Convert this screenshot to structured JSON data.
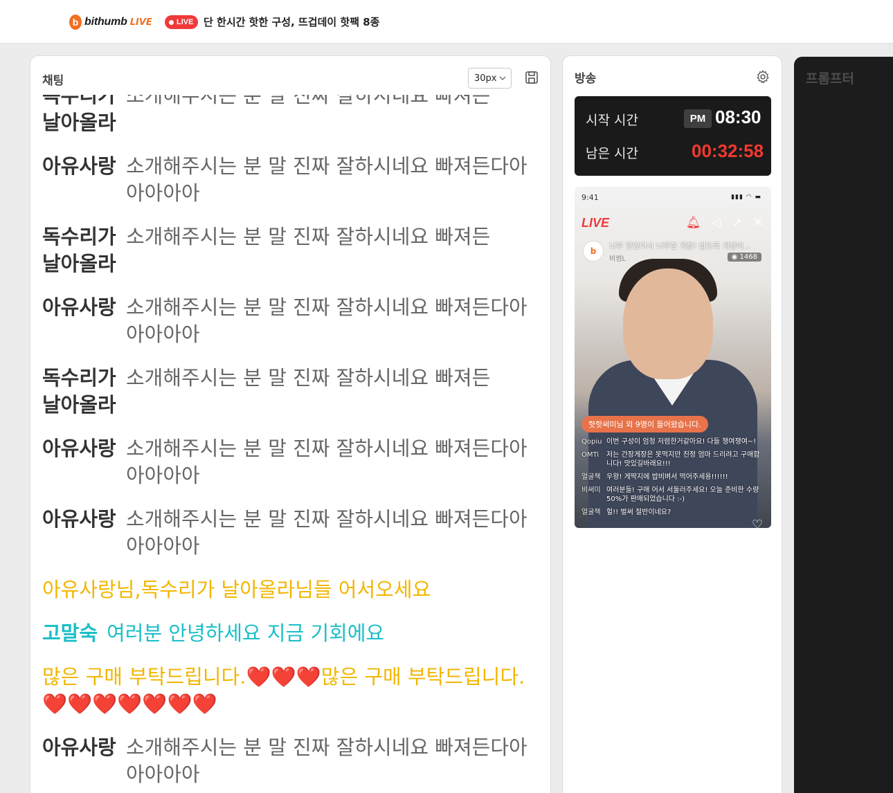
{
  "header": {
    "logo_text": "bithumb",
    "logo_live": "LIVE",
    "live_badge": "LIVE",
    "title": "단 한시간 핫한 구성, 뜨겁데이 핫팩 8종"
  },
  "chat": {
    "title": "채팅",
    "font_size_select": "30px",
    "messages": [
      {
        "nick": "독수리가 날아올라",
        "text": "소개해주시는 분 말 진짜 잘하시네요 빠져든"
      },
      {
        "nick": "아유사랑",
        "text": "소개해주시는 분 말 진짜 잘하시네요 빠져든다아아아아아"
      },
      {
        "nick": "독수리가 날아올라",
        "text": "소개해주시는 분 말 진짜 잘하시네요 빠져든"
      },
      {
        "nick": "아유사랑",
        "text": "소개해주시는 분 말 진짜 잘하시네요 빠져든다아아아아아"
      },
      {
        "nick": "독수리가 날아올라",
        "text": "소개해주시는 분 말 진짜 잘하시네요 빠져든"
      },
      {
        "nick": "아유사랑",
        "text": "소개해주시는 분 말 진짜 잘하시네요 빠져든다아아아아아"
      },
      {
        "nick": "아유사랑",
        "text": "소개해주시는 분 말 진짜 잘하시네요 빠져든다아아아아아"
      }
    ],
    "welcome": "아유사랑님,독수리가 날아올라님들 어서오세요",
    "host_nick": "고말숙",
    "host_text": "여러분 안녕하세요 지금 기회에요",
    "notice": "많은 구매 부탁드립니다.❤️❤️❤️많은 구매 부탁드립니다.❤️❤️❤️❤️❤️❤️❤️",
    "last_nick": "아유사랑",
    "last_text": "소개해주시는 분 말 진짜 잘하시네요 빠져든다아아아아아"
  },
  "broadcast": {
    "title": "방송",
    "start_label": "시작 시간",
    "ampm": "PM",
    "start_time": "08:30",
    "remain_label": "남은 시간",
    "remain_time": "00:32:58",
    "preview": {
      "clock": "9:41",
      "live": "LIVE",
      "stream_title": "너무 맛있어서 너무한 게장! 밥도둑 게장이...",
      "channel": "비썸L",
      "viewers": "1468",
      "joined": "핫핫써미님 외 9명이 들어왔습니다.",
      "chat": [
        {
          "n": "Qopiu",
          "t": "이번 구성이 엄청 저렴한거같아요! 다들 챙여쟁여~!"
        },
        {
          "n": "OMTi",
          "t": "저는 간장게장은 못먹지만 친정 엄마 드리려고 구매합니다! 맛있길바래요!!!"
        },
        {
          "n": "얼굴책",
          "t": "우왕! 게딱지에 밥비벼서 먹어주세용!!!!!!"
        },
        {
          "n": "비써미",
          "t": "여러분들! 구매 어서 서둘러주세요! 오늘 준비한 수량 50%가 판매되었습니다 :-)"
        },
        {
          "n": "얼굴책",
          "t": "헐!! 벌써 절반이네요?"
        }
      ]
    }
  },
  "prompter": {
    "title": "프롬프터"
  }
}
